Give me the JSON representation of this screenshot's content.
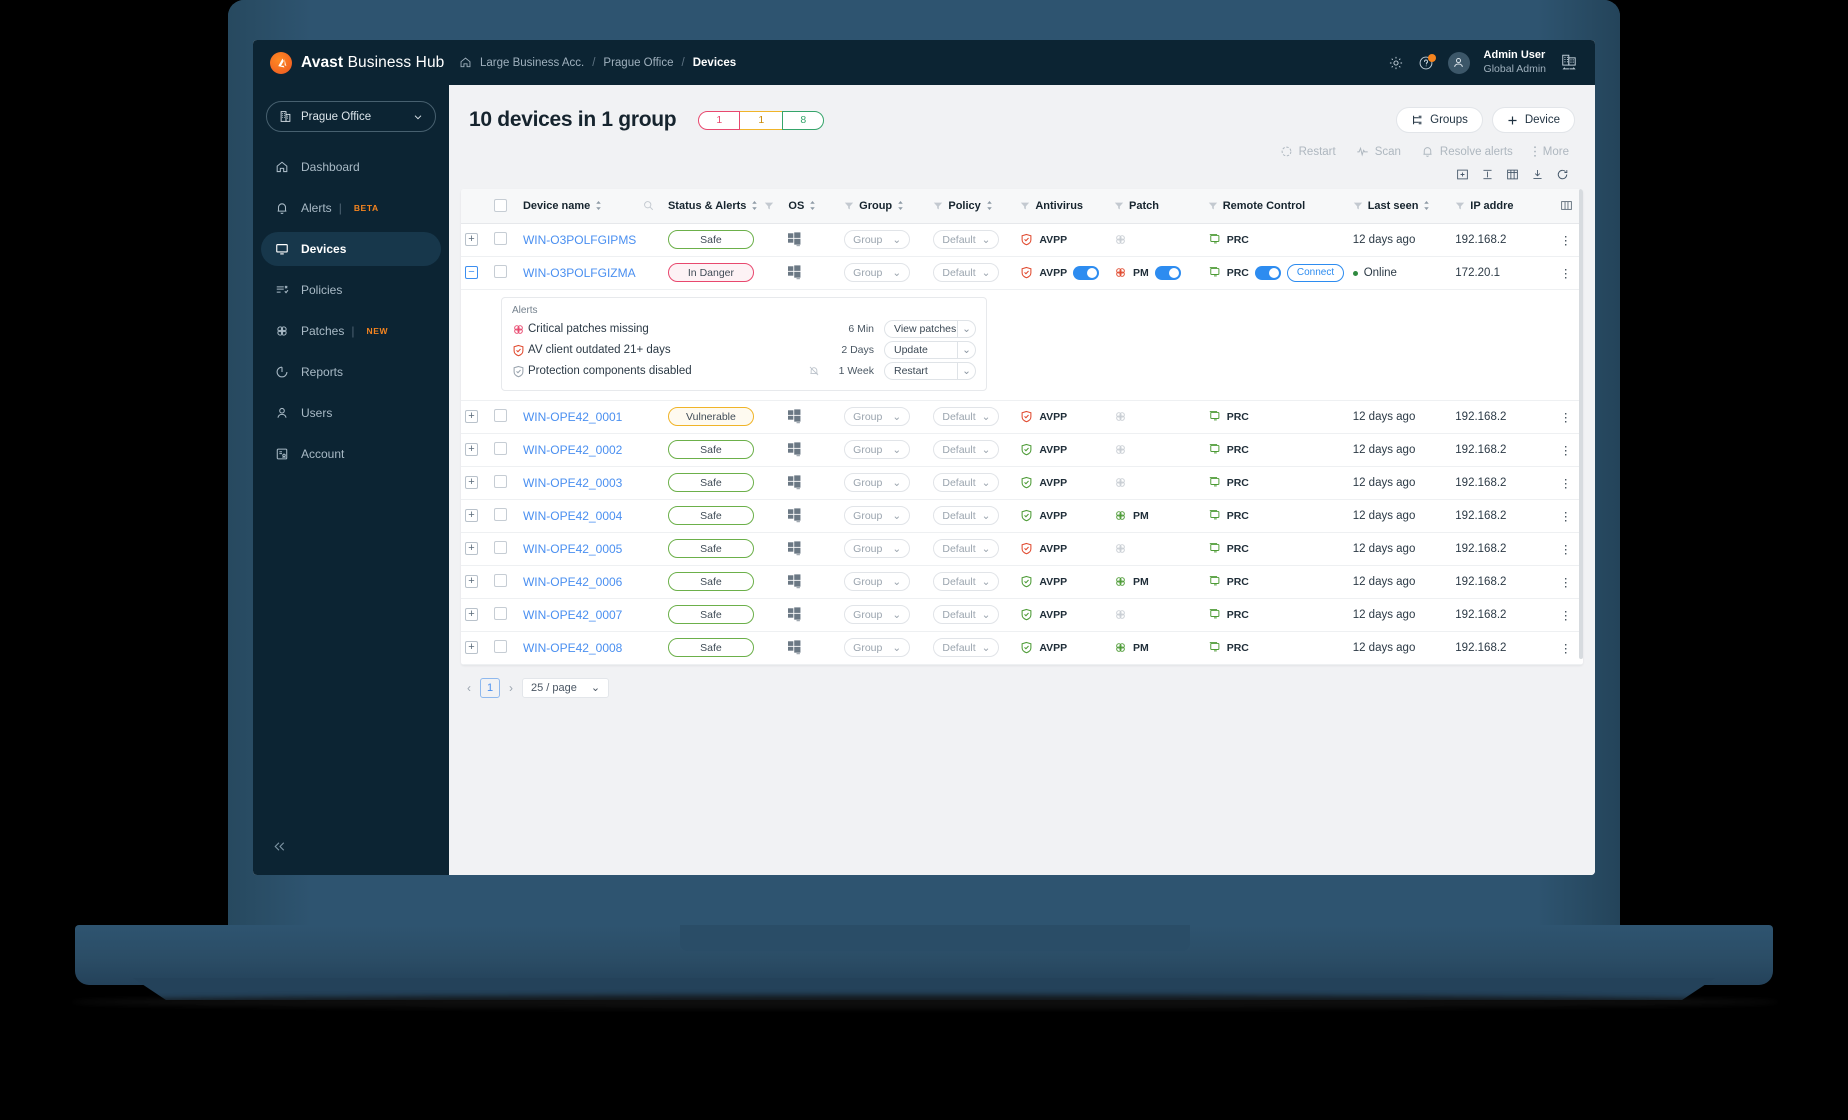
{
  "brand": {
    "name_bold": "Avast",
    "name_rest": " Business Hub",
    "logo_icon": "avast-logo-icon"
  },
  "breadcrumb": {
    "home_icon": "home-icon",
    "items": [
      "Large Business Acc.",
      "Prague Office",
      "Devices"
    ],
    "separator": "/"
  },
  "topbar": {
    "gear_icon": "gear-icon",
    "help_icon": "help-circle-icon",
    "user_name": "Admin User",
    "user_role": "Global Admin",
    "avatar_icon": "user-avatar-icon",
    "switch_company_icon": "building-switch-icon"
  },
  "sidebar": {
    "office_selector": {
      "label": "Prague Office",
      "icon": "building-icon",
      "chevron": "chevron-down-icon"
    },
    "items": [
      {
        "label": "Dashboard",
        "icon": "home-icon",
        "active": false,
        "tag": ""
      },
      {
        "label": "Alerts",
        "icon": "bell-icon",
        "active": false,
        "tag": "BETA"
      },
      {
        "label": "Devices",
        "icon": "monitor-icon",
        "active": true,
        "tag": ""
      },
      {
        "label": "Policies",
        "icon": "policies-icon",
        "active": false,
        "tag": ""
      },
      {
        "label": "Patches",
        "icon": "patch-icon",
        "active": false,
        "tag": "NEW"
      },
      {
        "label": "Reports",
        "icon": "pie-chart-icon",
        "active": false,
        "tag": ""
      },
      {
        "label": "Users",
        "icon": "user-icon",
        "active": false,
        "tag": ""
      },
      {
        "label": "Account",
        "icon": "account-icon",
        "active": false,
        "tag": ""
      }
    ],
    "collapse_icon": "chevron-double-left-icon"
  },
  "main": {
    "title": "10 devices in 1 group",
    "status_pills": [
      {
        "value": "1",
        "color": "#e8486e"
      },
      {
        "value": "1",
        "color": "#f0b429"
      },
      {
        "value": "8",
        "color": "#35a46a"
      }
    ],
    "head_buttons": [
      {
        "label": "Groups",
        "icon": "hierarchy-icon"
      },
      {
        "label": "Device",
        "icon": "plus-icon"
      }
    ],
    "toolbar": [
      {
        "label": "Restart",
        "icon": "restart-icon"
      },
      {
        "label": "Scan",
        "icon": "scan-icon"
      },
      {
        "label": "Resolve alerts",
        "icon": "bell-icon"
      },
      {
        "label": "More",
        "icon": "kebab-icon"
      }
    ],
    "view_icons": [
      "expand-view-icon",
      "row-height-icon",
      "columns-icon",
      "download-icon",
      "refresh-icon"
    ]
  },
  "table": {
    "columns": [
      {
        "label": "Device name",
        "sortable": true,
        "search": true
      },
      {
        "label": "Status & Alerts",
        "sortable": true,
        "filter": true
      },
      {
        "label": "OS",
        "sortable": true,
        "filter": true
      },
      {
        "label": "Group",
        "sortable": true,
        "filter": true
      },
      {
        "label": "Policy",
        "sortable": true,
        "filter": true
      },
      {
        "label": "Antivirus",
        "sortable": false,
        "filter": true
      },
      {
        "label": "Patch",
        "sortable": false,
        "filter": true
      },
      {
        "label": "Remote Control",
        "sortable": false,
        "filter": true
      },
      {
        "label": "Last seen",
        "sortable": true,
        "filter": true
      },
      {
        "label": "IP addre",
        "sortable": false,
        "filter": false
      }
    ],
    "columns_settings_icon": "columns-settings-icon",
    "select_all_checkbox": "select-all-checkbox",
    "group_placeholder": "Group",
    "policy_placeholder": "Default",
    "av_label": "AVPP",
    "pm_label": "PM",
    "prc_label": "PRC",
    "connect_label": "Connect",
    "online_label": "Online",
    "rows": [
      {
        "name": "WIN-O3POLFGIPMS",
        "status": "Safe",
        "status_kind": "safe",
        "av_color": "#e04a2f",
        "patch": "",
        "patch_color": "#c9ced4",
        "last_seen": "12 days ago",
        "ip": "192.168.2",
        "expanded": false
      },
      {
        "name": "WIN-O3POLFGIZMA",
        "status": "In Danger",
        "status_kind": "danger",
        "av_color": "#e04a2f",
        "patch": "PM",
        "patch_color": "#e04a2f",
        "last_seen": "Online",
        "ip": "172.20.1",
        "expanded": true
      },
      {
        "name": "WIN-OPE42_0001",
        "status": "Vulnerable",
        "status_kind": "vuln",
        "av_color": "#e04a2f",
        "patch": "",
        "patch_color": "#c9ced4",
        "last_seen": "12 days ago",
        "ip": "192.168.2",
        "expanded": false
      },
      {
        "name": "WIN-OPE42_0002",
        "status": "Safe",
        "status_kind": "safe",
        "av_color": "#4d9b36",
        "patch": "",
        "patch_color": "#c9ced4",
        "last_seen": "12 days ago",
        "ip": "192.168.2",
        "expanded": false
      },
      {
        "name": "WIN-OPE42_0003",
        "status": "Safe",
        "status_kind": "safe",
        "av_color": "#4d9b36",
        "patch": "",
        "patch_color": "#c9ced4",
        "last_seen": "12 days ago",
        "ip": "192.168.2",
        "expanded": false
      },
      {
        "name": "WIN-OPE42_0004",
        "status": "Safe",
        "status_kind": "safe",
        "av_color": "#4d9b36",
        "patch": "PM",
        "patch_color": "#4d9b36",
        "last_seen": "12 days ago",
        "ip": "192.168.2",
        "expanded": false
      },
      {
        "name": "WIN-OPE42_0005",
        "status": "Safe",
        "status_kind": "safe",
        "av_color": "#e04a2f",
        "patch": "",
        "patch_color": "#c9ced4",
        "last_seen": "12 days ago",
        "ip": "192.168.2",
        "expanded": false
      },
      {
        "name": "WIN-OPE42_0006",
        "status": "Safe",
        "status_kind": "safe",
        "av_color": "#4d9b36",
        "patch": "PM",
        "patch_color": "#4d9b36",
        "last_seen": "12 days ago",
        "ip": "192.168.2",
        "expanded": false
      },
      {
        "name": "WIN-OPE42_0007",
        "status": "Safe",
        "status_kind": "safe",
        "av_color": "#4d9b36",
        "patch": "",
        "patch_color": "#c9ced4",
        "last_seen": "12 days ago",
        "ip": "192.168.2",
        "expanded": false
      },
      {
        "name": "WIN-OPE42_0008",
        "status": "Safe",
        "status_kind": "safe",
        "av_color": "#4d9b36",
        "patch": "PM",
        "patch_color": "#4d9b36",
        "last_seen": "12 days ago",
        "ip": "192.168.2",
        "expanded": false
      }
    ]
  },
  "alerts_panel": {
    "title": "Alerts",
    "rows": [
      {
        "icon": "patch-icon",
        "icon_color": "#e8486e",
        "text": "Critical patches missing",
        "muted": false,
        "time": "6 Min",
        "action": "View patches"
      },
      {
        "icon": "shield-icon",
        "icon_color": "#e04a2f",
        "text": "AV client outdated 21+ days",
        "muted": false,
        "time": "2 Days",
        "action": "Update"
      },
      {
        "icon": "shield-icon",
        "icon_color": "#9aa4ae",
        "text": "Protection components disabled",
        "muted": true,
        "time": "1 Week",
        "action": "Restart"
      }
    ]
  },
  "pagination": {
    "prev_icon": "chevron-left-icon",
    "next_icon": "chevron-right-icon",
    "current_page": "1",
    "page_size": "25 / page",
    "chevron": "chevron-down-icon"
  }
}
